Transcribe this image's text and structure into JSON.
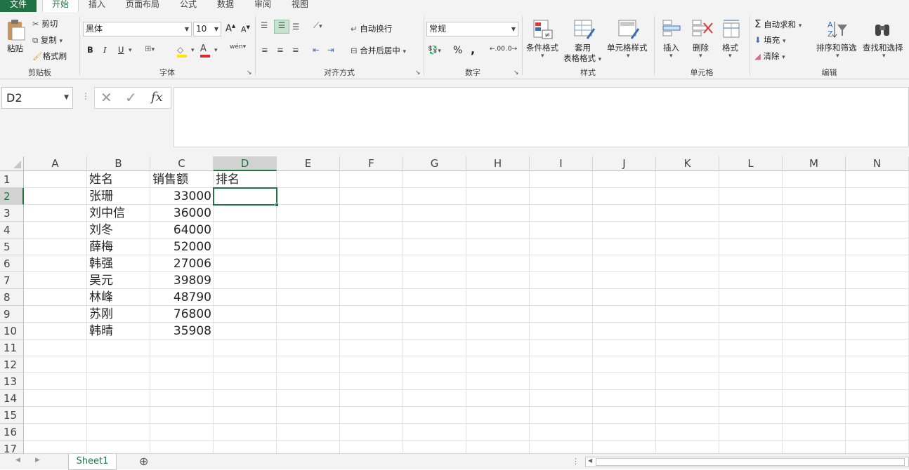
{
  "tabs": [
    "文件",
    "开始",
    "插入",
    "页面布局",
    "公式",
    "数据",
    "审阅",
    "视图"
  ],
  "ribbon": {
    "clipboard": {
      "paste": "粘贴",
      "cut": "剪切",
      "copy": "复制",
      "format_painter": "格式刷",
      "label": "剪贴板"
    },
    "font": {
      "name": "黑体",
      "size": "10",
      "bold": "B",
      "italic": "I",
      "underline": "U",
      "label": "字体",
      "grow": "A",
      "shrink": "A",
      "wen": "wén"
    },
    "alignment": {
      "wrap": "自动换行",
      "merge": "合并后居中",
      "label": "对齐方式"
    },
    "number": {
      "format": "常规",
      "percent": "%",
      "comma": ",",
      "inc_decimal": ".00",
      "dec_decimal": ".0",
      "label": "数字"
    },
    "styles": {
      "conditional": "条件格式",
      "table_format_1": "套用",
      "table_format_2": "表格格式",
      "cell_styles": "单元格样式",
      "label": "样式"
    },
    "cells": {
      "insert": "插入",
      "delete": "删除",
      "format": "格式",
      "label": "单元格"
    },
    "editing": {
      "autosum": "自动求和",
      "fill": "填充",
      "clear": "清除",
      "sort_filter": "排序和筛选",
      "find_select": "查找和选择",
      "label": "编辑"
    }
  },
  "formula_bar": {
    "name_box": "D2",
    "cancel": "✕",
    "enter": "✓",
    "fx": "fx",
    "formula": ""
  },
  "columns": [
    "A",
    "B",
    "C",
    "D",
    "E",
    "F",
    "G",
    "H",
    "I",
    "J",
    "K",
    "L",
    "M",
    "N"
  ],
  "rows": [
    "1",
    "2",
    "3",
    "4",
    "5",
    "6",
    "7",
    "8",
    "9",
    "10",
    "11",
    "12",
    "13",
    "14",
    "15",
    "16",
    "17"
  ],
  "table": {
    "headers": [
      "姓名",
      "销售额",
      "排名"
    ],
    "data": [
      {
        "name": "张珊",
        "sales": "33000"
      },
      {
        "name": "刘中信",
        "sales": "36000"
      },
      {
        "name": "刘冬",
        "sales": "64000"
      },
      {
        "name": "薛梅",
        "sales": "52000"
      },
      {
        "name": "韩强",
        "sales": "27006"
      },
      {
        "name": "吴元",
        "sales": "39809"
      },
      {
        "name": "林峰",
        "sales": "48790"
      },
      {
        "name": "苏刚",
        "sales": "76800"
      },
      {
        "name": "韩晴",
        "sales": "35908"
      }
    ]
  },
  "status": {
    "sheet": "Sheet1",
    "add": "⊕"
  },
  "colors": {
    "accent": "#217346",
    "ribbon_bg": "#f3f3f3",
    "font_color": "#d92b2b",
    "highlight": "#ffe600"
  }
}
